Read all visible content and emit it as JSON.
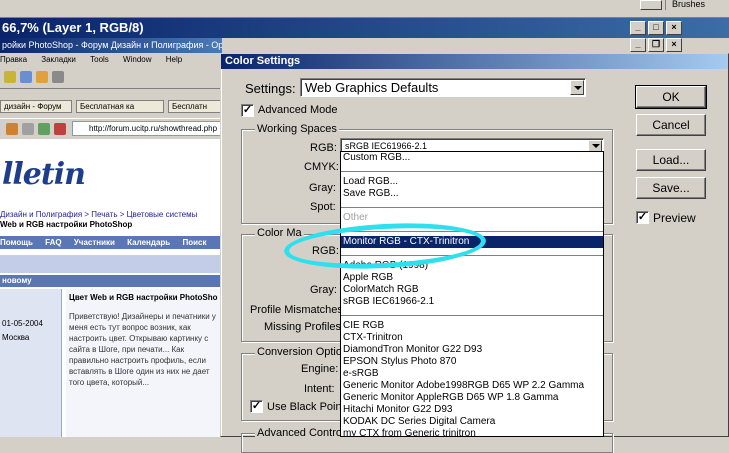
{
  "photoshop": {
    "window_title": "66,7% (Layer 1, RGB/8)",
    "brushes_tab": "Brushes"
  },
  "browser": {
    "title": "ройки PhotoShop - Форум Дизайн и Полиграфия - Opera",
    "menu": [
      "Правка",
      "Закладки",
      "Tools",
      "Window",
      "Help"
    ],
    "tabs": [
      "дизайн - Форум",
      "Бесплатная ка",
      "Бесплатн"
    ],
    "address": "http://forum.ucitp.ru/showthread.php",
    "logo": "lletin",
    "breadcrumbs": [
      "Дизайн и Полиграфия",
      "Печать",
      "Цветовые системы"
    ],
    "breadcrumb_line2": "Web и RGB настройки PhotoShop",
    "nav_items": [
      "Помощь",
      "FAQ",
      "Участники",
      "Календарь",
      "Поиск"
    ],
    "section_label": "новому",
    "post_title": "Цвет Web и RGB настройки PhotoSho",
    "post_date": "01-05-2004",
    "post_location": "Москва",
    "post_text": "Приветствую! Дизайнеры и печатники у меня есть тут вопрос возник, как настроить цвет. Открываю картинку с сайта в Шоге, при печати... Как правильно настроить профиль, если вставлять в Шоге один из них не дает того цвета, который..."
  },
  "dialog": {
    "title": "Color Settings",
    "settings_label": "Settings:",
    "settings_value": "Web Graphics Defaults",
    "advanced_mode_label": "Advanced Mode",
    "advanced_mode_checked": true,
    "working_spaces_label": "Working Spaces",
    "rgb_label": "RGB:",
    "rgb_value": "sRGB IEC61966-2.1",
    "cmyk_label": "CMYK:",
    "gray_label": "Gray:",
    "spot_label": "Spot:",
    "color_management_label": "Color Ma",
    "cm_rgb_label": "RGB:",
    "cm_gray_label": "Gray:",
    "profile_mismatches_label": "Profile Mismatches:",
    "missing_profiles_label": "Missing Profiles:",
    "conversion_options_label": "Conversion Optio",
    "engine_label": "Engine:",
    "intent_label": "Intent:",
    "black_point_label": "Use Black Point",
    "black_point_checked": true,
    "advanced_controls_label": "Advanced Contro",
    "buttons": {
      "ok": "OK",
      "cancel": "Cancel",
      "load": "Load...",
      "save": "Save..."
    },
    "preview_label": "Preview",
    "preview_checked": true
  },
  "rgb_dropdown": {
    "items": [
      {
        "label": "Custom RGB...",
        "state": "normal"
      },
      {
        "label": "Load RGB...",
        "state": "normal"
      },
      {
        "label": "Save RGB...",
        "state": "normal"
      },
      {
        "label": "Other",
        "state": "disabled"
      },
      {
        "label": "Monitor RGB - CTX-Trinitron",
        "state": "selected"
      },
      {
        "label": "Adobe RGB (1998)",
        "state": "normal"
      },
      {
        "label": "Apple RGB",
        "state": "normal"
      },
      {
        "label": "ColorMatch RGB",
        "state": "normal"
      },
      {
        "label": "sRGB IEC61966-2.1",
        "state": "normal"
      },
      {
        "label": "CIE RGB",
        "state": "normal"
      },
      {
        "label": "CTX-Trinitron",
        "state": "normal"
      },
      {
        "label": "DiamondTron Monitor G22 D93",
        "state": "normal"
      },
      {
        "label": "EPSON Stylus Photo 870",
        "state": "normal"
      },
      {
        "label": "e-sRGB",
        "state": "normal"
      },
      {
        "label": "Generic Monitor Adobe1998RGB D65 WP 2.2 Gamma",
        "state": "normal"
      },
      {
        "label": "Generic Monitor AppleRGB D65 WP 1.8 Gamma",
        "state": "normal"
      },
      {
        "label": "Hitachi Monitor G22 D93",
        "state": "normal"
      },
      {
        "label": "KODAK DC Series Digital Camera",
        "state": "normal"
      },
      {
        "label": "my CTX from Generic trinitron",
        "state": "normal"
      }
    ]
  },
  "colors": {
    "annotation": "#2ee0ee",
    "selection": "#0a246a",
    "dialog_bg": "#d4d0c8"
  }
}
